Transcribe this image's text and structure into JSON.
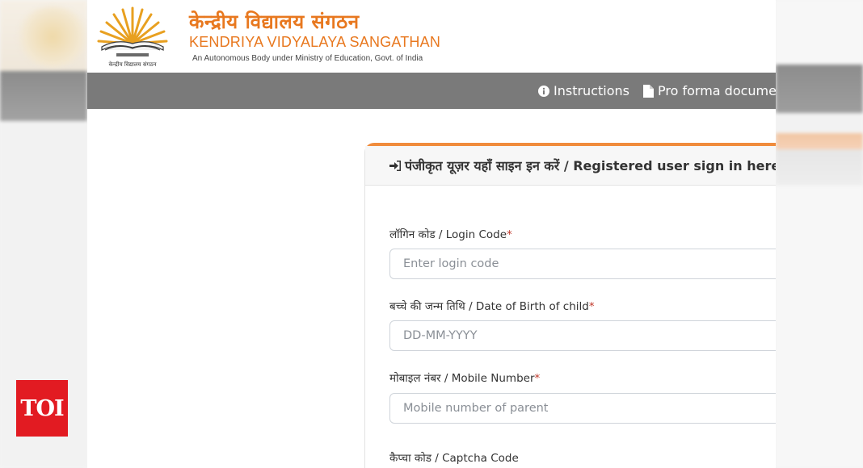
{
  "header": {
    "logo_caption": "केन्द्रीय विद्यालय संगठन",
    "title_hindi": "केन्द्रीय विद्यालय संगठन",
    "title_english": "KENDRIYA VIDYALAYA SANGATHAN",
    "subtitle": "An Autonomous Body under Ministry of Education, Govt. of India"
  },
  "nav": {
    "instructions": {
      "label": "Instructions",
      "icon": "info-circle-icon"
    },
    "proforma": {
      "label": "Pro forma docume",
      "icon": "file-icon"
    }
  },
  "card": {
    "header_icon": "sign-in-icon",
    "header_text": "पंजीकृत यूज़र यहाँ साइन इन करें / Registered user sign in here",
    "accent_color": "#f08c3c",
    "fields": [
      {
        "label": "लॉगिन कोड / Login Code",
        "required": "*",
        "placeholder": "Enter login code",
        "value": ""
      },
      {
        "label": "बच्चे की जन्म तिथि / Date of Birth of child",
        "required": "*",
        "placeholder": "DD-MM-YYYY",
        "value": ""
      },
      {
        "label": "मोबाइल नंबर / Mobile Number",
        "required": "*",
        "placeholder": "Mobile number of parent",
        "value": ""
      },
      {
        "label": "कैप्चा कोड / Captcha Code"
      }
    ]
  },
  "watermark": {
    "text": "TOI",
    "color": "#e21b22"
  },
  "colors": {
    "brand_orange": "#e8781f",
    "navbar": "#7a7a7a"
  }
}
